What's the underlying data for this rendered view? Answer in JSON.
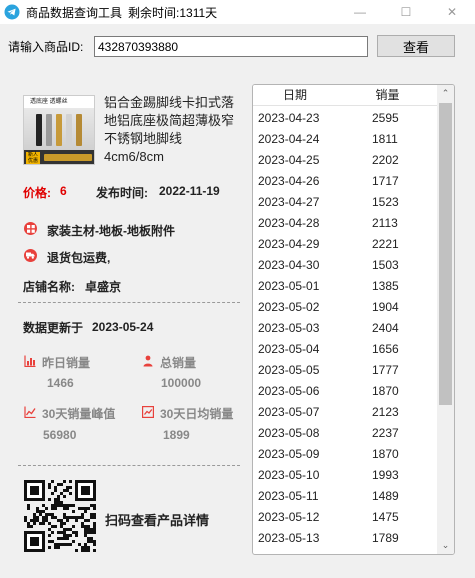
{
  "window": {
    "title": "商品数据查询工具",
    "remaining_label": "剩余时间:",
    "remaining_value": "1311天",
    "minimize": "—",
    "maximize": "☐",
    "close": "✕"
  },
  "search": {
    "label": "请输入商品ID:",
    "value": "432870393880",
    "button": "查看"
  },
  "product": {
    "thumb_text": "透底座 透螺丝",
    "thumb_badge": "新人优惠",
    "title": "铝合金踢脚线卡扣式落地铝底座极简超薄极窄不锈钢地脚线4cm6/8cm",
    "price_label": "价格:",
    "price_value": "6",
    "publish_label": "发布时间:",
    "publish_value": "2022-11-19",
    "category": "家装主材-地板-地板附件",
    "returns": "退货包运费,",
    "shop_label": "店铺名称:",
    "shop_value": "卓盛京"
  },
  "update": {
    "label": "数据更新于",
    "value": "2023-05-24"
  },
  "stats": {
    "yesterday_label": "昨日销量",
    "yesterday_value": "1466",
    "total_label": "总销量",
    "total_value": "100000",
    "peak30_label": "30天销量峰值",
    "peak30_value": "56980",
    "avg30_label": "30天日均销量",
    "avg30_value": "1899"
  },
  "qr": {
    "caption": "扫码查看产品详情"
  },
  "table": {
    "headers": {
      "date": "日期",
      "sales": "销量"
    },
    "rows": [
      {
        "date": "2023-04-23",
        "sales": "2595"
      },
      {
        "date": "2023-04-24",
        "sales": "1811"
      },
      {
        "date": "2023-04-25",
        "sales": "2202"
      },
      {
        "date": "2023-04-26",
        "sales": "1717"
      },
      {
        "date": "2023-04-27",
        "sales": "1523"
      },
      {
        "date": "2023-04-28",
        "sales": "2113"
      },
      {
        "date": "2023-04-29",
        "sales": "2221"
      },
      {
        "date": "2023-04-30",
        "sales": "1503"
      },
      {
        "date": "2023-05-01",
        "sales": "1385"
      },
      {
        "date": "2023-05-02",
        "sales": "1904"
      },
      {
        "date": "2023-05-03",
        "sales": "2404"
      },
      {
        "date": "2023-05-04",
        "sales": "1656"
      },
      {
        "date": "2023-05-05",
        "sales": "1777"
      },
      {
        "date": "2023-05-06",
        "sales": "1870"
      },
      {
        "date": "2023-05-07",
        "sales": "2123"
      },
      {
        "date": "2023-05-08",
        "sales": "2237"
      },
      {
        "date": "2023-05-09",
        "sales": "1870"
      },
      {
        "date": "2023-05-10",
        "sales": "1993"
      },
      {
        "date": "2023-05-11",
        "sales": "1489"
      },
      {
        "date": "2023-05-12",
        "sales": "1475"
      },
      {
        "date": "2023-05-13",
        "sales": "1789"
      }
    ]
  },
  "icons": {
    "app": "telegram-icon",
    "category": "grid-icon",
    "returns": "truck-icon",
    "yesterday": "bar-chart-icon",
    "total": "person-chart-icon",
    "peak30": "line-chart-icon",
    "avg30": "trend-chart-icon"
  },
  "colors": {
    "price": "#e00000",
    "accent_icon": "#e8413c",
    "app_icon": "#2aa3de"
  }
}
